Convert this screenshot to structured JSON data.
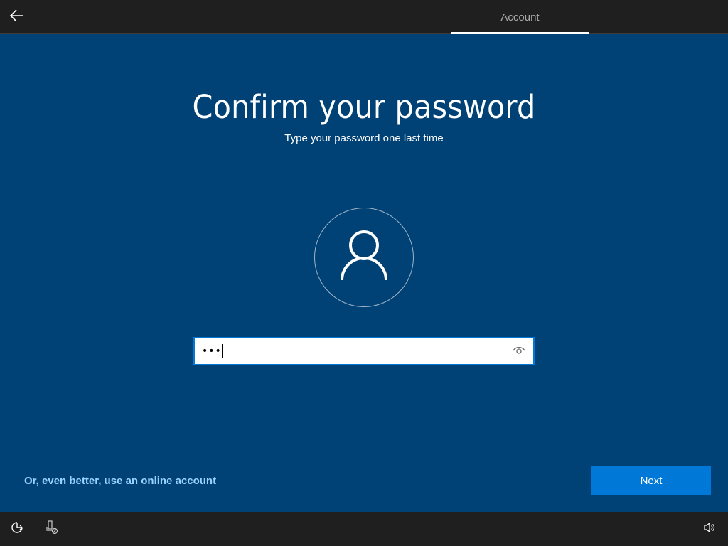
{
  "header": {
    "back_icon": "arrow-left-icon",
    "active_tab": "Account"
  },
  "main": {
    "title": "Confirm your password",
    "subtitle": "Type your password one last time",
    "avatar_icon": "user-icon",
    "password_field": {
      "value": "•••",
      "reveal_icon": "eye-icon"
    },
    "online_account_link": "Or, even better, use an online account",
    "next_label": "Next"
  },
  "footer": {
    "icons": [
      "ease-of-access-icon",
      "microphone-off-icon",
      "volume-icon"
    ]
  },
  "colors": {
    "background": "#004275",
    "bar": "#1f1f1f",
    "accent": "#0078d7",
    "link": "#99d1ff"
  }
}
